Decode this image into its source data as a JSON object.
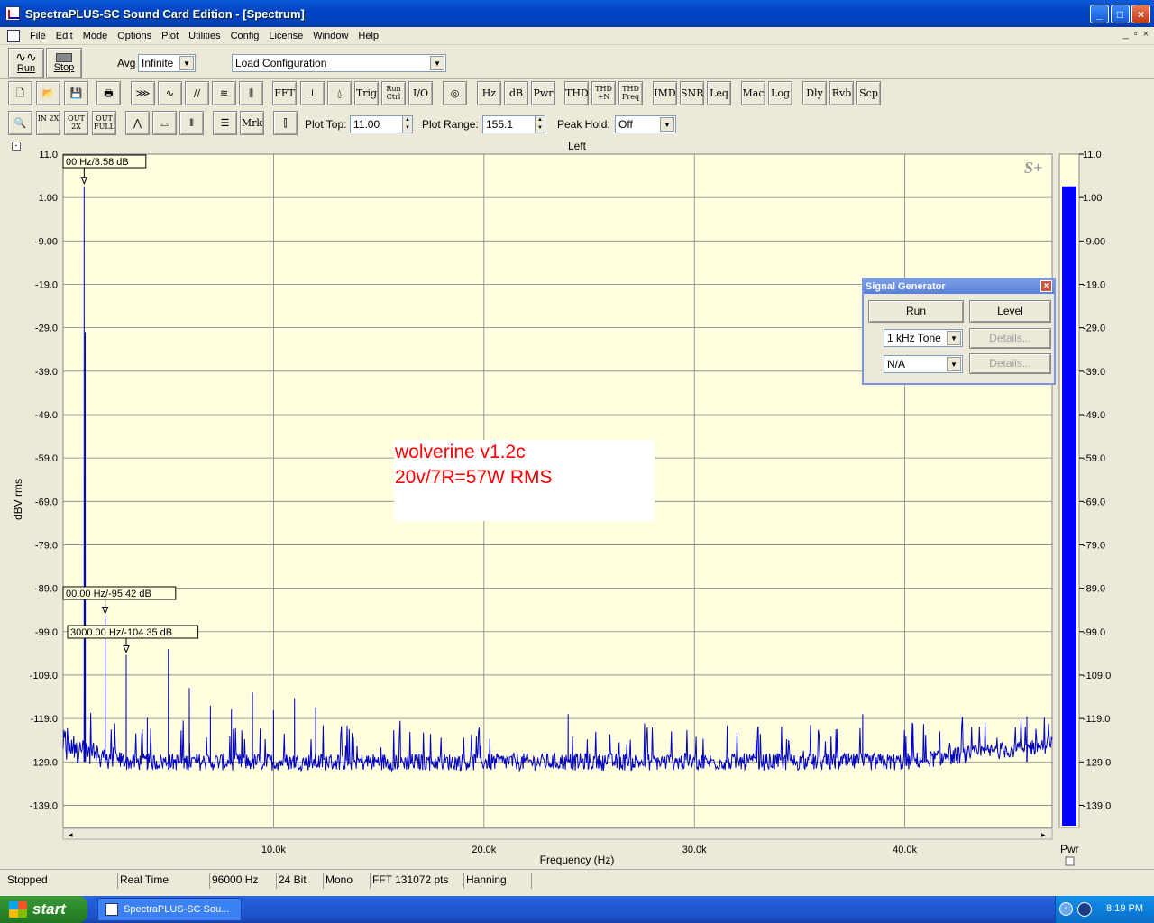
{
  "window": {
    "title": "SpectraPLUS-SC Sound Card Edition - [Spectrum]",
    "controls": [
      "_",
      "□",
      "×"
    ]
  },
  "menu": {
    "items": [
      "File",
      "Edit",
      "Mode",
      "Options",
      "Plot",
      "Utilities",
      "Config",
      "License",
      "Window",
      "Help"
    ],
    "mdi_controls": [
      "_",
      "▫",
      "×"
    ]
  },
  "toolbar1": {
    "run_label": "Run",
    "stop_label": "Stop",
    "avg_label": "Avg",
    "avg_value": "Infinite",
    "load_config_value": "Load Configuration"
  },
  "toolbar2": {
    "buttons": [
      {
        "name": "new-icon",
        "text": "🗋"
      },
      {
        "name": "open-icon",
        "text": "📂"
      },
      {
        "name": "save-icon",
        "text": "💾"
      },
      {
        "name": "print-icon",
        "text": "🖶"
      },
      {
        "name": "waveform-icon",
        "text": "⋙"
      },
      {
        "name": "spectrum-icon",
        "text": "∿"
      },
      {
        "name": "phase-icon",
        "text": "∕∕"
      },
      {
        "name": "spectrogram-icon",
        "text": "≋"
      },
      {
        "name": "3d-surface-icon",
        "text": "⫼"
      },
      {
        "name": "fft-button",
        "text": "FFT"
      },
      {
        "name": "scaling-icon",
        "text": "⊥"
      },
      {
        "name": "averaging-icon",
        "text": "⍙"
      },
      {
        "name": "trig-button",
        "text": "Trig"
      },
      {
        "name": "run-ctrl-button",
        "text": "Run Ctrl"
      },
      {
        "name": "io-button",
        "text": "I/O"
      },
      {
        "name": "generator-icon",
        "text": "◎"
      },
      {
        "name": "hz-button",
        "text": "Hz"
      },
      {
        "name": "db-button",
        "text": "dB"
      },
      {
        "name": "pwr-button",
        "text": "Pwr"
      },
      {
        "name": "thd-button",
        "text": "THD"
      },
      {
        "name": "thd-n-button",
        "text": "THD +N"
      },
      {
        "name": "thd-freq-button",
        "text": "THD Freq"
      },
      {
        "name": "imd-button",
        "text": "IMD"
      },
      {
        "name": "snr-button",
        "text": "SNR"
      },
      {
        "name": "leq-button",
        "text": "Leq"
      },
      {
        "name": "mac-button",
        "text": "Mac"
      },
      {
        "name": "log-button",
        "text": "Log"
      },
      {
        "name": "dly-button",
        "text": "Dly"
      },
      {
        "name": "rvb-button",
        "text": "Rvb"
      },
      {
        "name": "scp-button",
        "text": "Scp"
      }
    ]
  },
  "toolbar3": {
    "buttons": [
      {
        "name": "zoom-icon",
        "text": "🔍"
      },
      {
        "name": "zoom-in-2x-button",
        "text": "IN 2X"
      },
      {
        "name": "zoom-out-2x-button",
        "text": "OUT 2X"
      },
      {
        "name": "zoom-out-full-button",
        "text": "OUT FULL"
      },
      {
        "name": "peak-icon",
        "text": "⋀"
      },
      {
        "name": "octave-icon",
        "text": "⌓"
      },
      {
        "name": "bars-icon",
        "text": "⫴"
      },
      {
        "name": "list-icon",
        "text": "☰"
      },
      {
        "name": "marker-button",
        "text": "Mrk"
      },
      {
        "name": "autoscale-icon",
        "text": "⫿"
      }
    ],
    "plot_top_label": "Plot Top:",
    "plot_top_value": "11.00",
    "plot_range_label": "Plot Range:",
    "plot_range_value": "155.1",
    "peak_hold_label": "Peak Hold:",
    "peak_hold_value": "Off"
  },
  "chart_data": {
    "type": "line",
    "title": "Left",
    "xlabel": "Frequency (Hz)",
    "ylabel": "dBV rms",
    "xlim": [
      0,
      47000
    ],
    "ylim": [
      -144.1,
      11.0
    ],
    "yticks": [
      "11.0",
      "1.00",
      "-9.00",
      "-19.0",
      "-29.0",
      "-39.0",
      "-49.0",
      "-59.0",
      "-69.0",
      "-79.0",
      "-89.0",
      "-99.0",
      "-109.0",
      "-119.0",
      "-129.0",
      "-139.0"
    ],
    "yticks_values": [
      11.0,
      1.0,
      -9.0,
      -19.0,
      -29.0,
      -39.0,
      -49.0,
      -59.0,
      -69.0,
      -79.0,
      -89.0,
      -99.0,
      -109.0,
      -119.0,
      -129.0,
      -139.0
    ],
    "xticks": [
      "10.0k",
      "20.0k",
      "30.0k",
      "40.0k"
    ],
    "xticks_values": [
      10000,
      20000,
      30000,
      40000
    ],
    "noise_floor": -129.0,
    "peaks": [
      {
        "x": 1000,
        "y": 3.58
      },
      {
        "x": 1050,
        "y": -30.0
      },
      {
        "x": 2000,
        "y": -95.42
      },
      {
        "x": 3000,
        "y": -104.35
      },
      {
        "x": 5000,
        "y": -103.0
      },
      {
        "x": 6000,
        "y": -112.0
      },
      {
        "x": 9000,
        "y": -113.0
      },
      {
        "x": 24000,
        "y": -118.0
      },
      {
        "x": 38000,
        "y": -118.0
      },
      {
        "x": 45800,
        "y": -118.5
      }
    ],
    "markers": [
      {
        "label": "00 Hz/3.58 dB",
        "x": 1000,
        "y": 3.58
      },
      {
        "label": "00.00 Hz/-95.42 dB",
        "x": 2000,
        "y": -95.42
      },
      {
        "label": "3000.00 Hz/-104.35 dB",
        "x": 3000,
        "y": -104.35
      }
    ],
    "annotation": [
      "wolverine v1.2c",
      "20v/7R=57W RMS"
    ],
    "logo": "S+",
    "grid": true,
    "colors": {
      "plot_bg": "#ffffe0",
      "trace": "#0000c0",
      "grid": "#808080",
      "annotation": "#ff0000"
    },
    "meter": {
      "label": "Pwr",
      "value": 3.58,
      "color": "#0000ff",
      "ticks": [
        "11.0",
        "1.00",
        "-9.00",
        "-19.0",
        "-29.0",
        "-39.0",
        "-49.0",
        "-59.0",
        "-69.0",
        "-79.0",
        "-89.0",
        "-99.0",
        "-109.0",
        "-119.0",
        "-129.0",
        "-139.0"
      ]
    }
  },
  "signal_generator": {
    "title": "Signal Generator",
    "run_label": "Run",
    "level_label": "Level",
    "tone_value": "1 kHz Tone",
    "second_value": "N/A",
    "details_label": "Details..."
  },
  "statusbar": {
    "fields": [
      "Stopped",
      "Real Time",
      "96000 Hz",
      "24 Bit",
      "Mono",
      "FFT 131072 pts",
      "Hanning"
    ]
  },
  "taskbar": {
    "start_label": "start",
    "task_label": "SpectraPLUS-SC Sou...",
    "clock": "8:19 PM"
  }
}
